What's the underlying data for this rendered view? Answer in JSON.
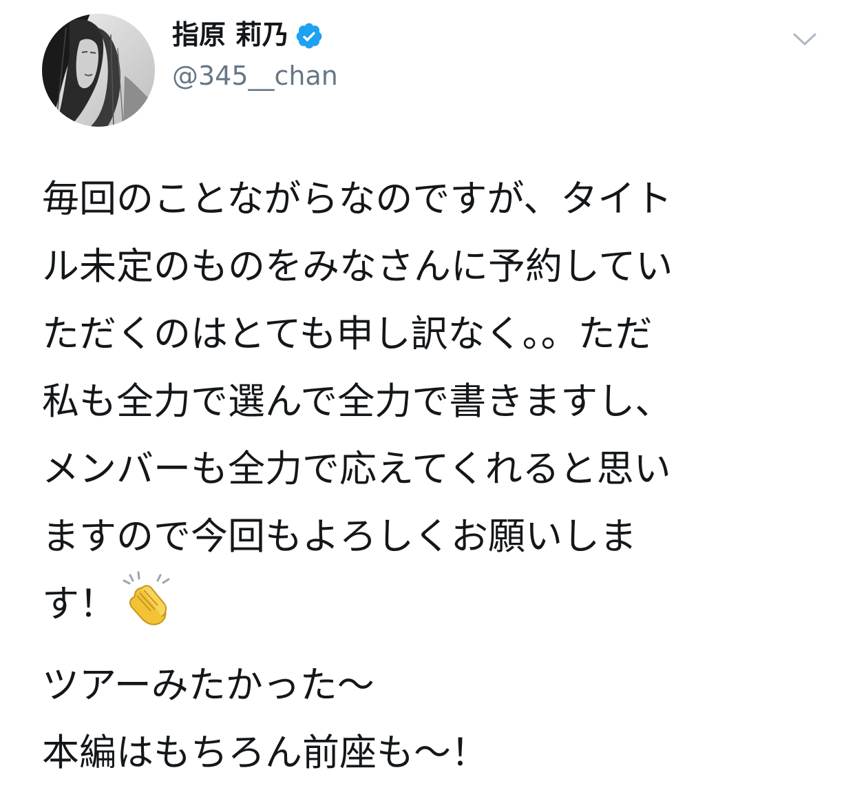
{
  "user": {
    "display_name": "指原 莉乃",
    "handle": "@345__chan",
    "verified_icon": "verified-badge-icon",
    "avatar_icon": "avatar-photo",
    "menu_icon": "chevron-down-icon"
  },
  "tweet": {
    "lines_first_paragraph": [
      "毎回のことながらなのですが、タイト",
      "ル未定のものをみなさんに予約してい",
      "ただくのはとても申し訳なく。。ただ",
      "私も全力で選んで全力で書きますし、",
      "メンバーも全力で応えてくれると思い",
      "ますので今回もよろしくお願いしま",
      "す！"
    ],
    "emoji": "clapping-hands-emoji",
    "lines_second_paragraph": [
      "ツアーみたかった〜",
      "本編はもちろん前座も〜！"
    ]
  },
  "colors": {
    "text": "#14171a",
    "handle": "#657786",
    "verified_blue": "#1da1f2",
    "chevron": "#aab8c2"
  }
}
